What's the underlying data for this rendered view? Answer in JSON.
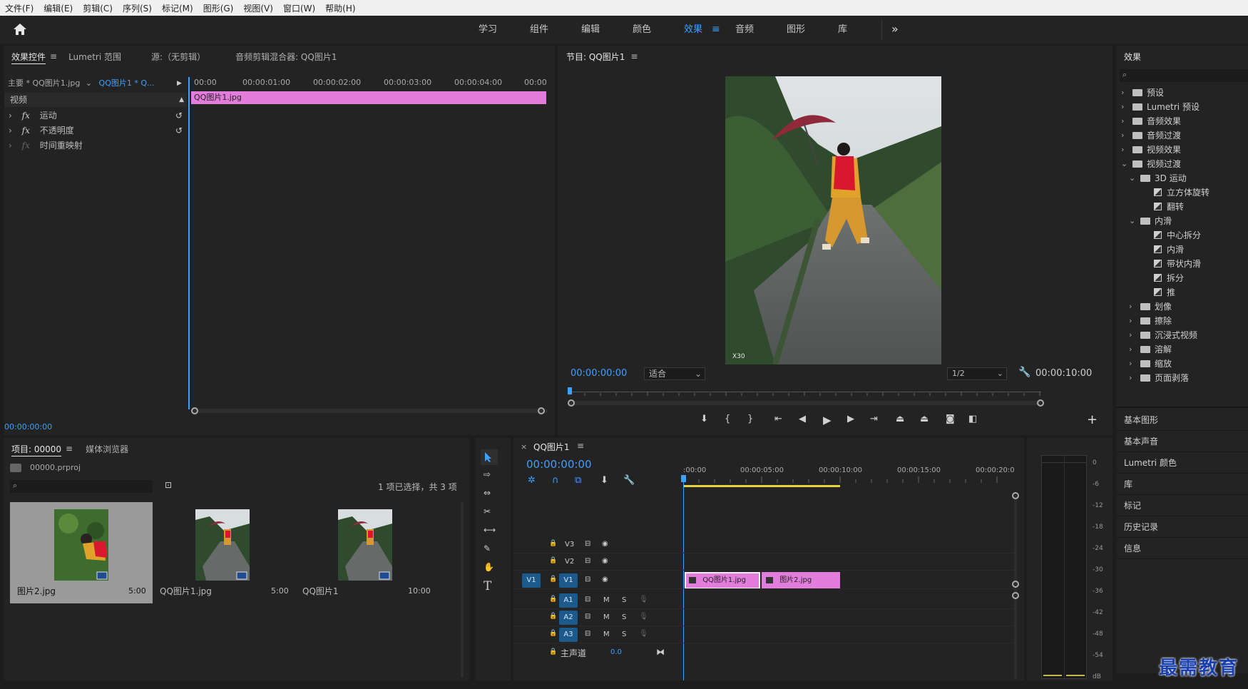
{
  "menu": [
    "文件(F)",
    "编辑(E)",
    "剪辑(C)",
    "序列(S)",
    "标记(M)",
    "图形(G)",
    "视图(V)",
    "窗口(W)",
    "帮助(H)"
  ],
  "workspaces": [
    "学习",
    "组件",
    "编辑",
    "颜色",
    "效果",
    "音频",
    "图形",
    "库"
  ],
  "active_workspace": "效果",
  "effect_controls": {
    "tabs": [
      "效果控件",
      "Lumetri 范围",
      "源:（无剪辑）",
      "音频剪辑混合器: QQ图片1"
    ],
    "source": "主要 * QQ图片1.jpg",
    "sequence": "QQ图片1 * Q...",
    "ruler": [
      "00:00",
      "00:00:01:00",
      "00:00:02:00",
      "00:00:03:00",
      "00:00:04:00",
      "00:00"
    ],
    "clip": "QQ图片1.jpg",
    "section": "视频",
    "props": [
      "运动",
      "不透明度",
      "时间重映射"
    ],
    "fx_label": "fx",
    "timecode": "00:00:00:00"
  },
  "program": {
    "title": "节目: QQ图片1",
    "timecode": "00:00:00:00",
    "fit": "适合",
    "resolution": "1/2",
    "duration": "00:00:10:00",
    "watermark": "X30"
  },
  "effects_panel": {
    "title": "效果",
    "tree": [
      {
        "label": "预设",
        "level": 0,
        "kind": "folder",
        "open": false
      },
      {
        "label": "Lumetri 预设",
        "level": 0,
        "kind": "folder",
        "open": false
      },
      {
        "label": "音频效果",
        "level": 0,
        "kind": "folder",
        "open": false
      },
      {
        "label": "音频过渡",
        "level": 0,
        "kind": "folder",
        "open": false
      },
      {
        "label": "视频效果",
        "level": 0,
        "kind": "folder",
        "open": false
      },
      {
        "label": "视频过渡",
        "level": 0,
        "kind": "folder",
        "open": true
      },
      {
        "label": "3D 运动",
        "level": 1,
        "kind": "folder",
        "open": true
      },
      {
        "label": "立方体旋转",
        "level": 2,
        "kind": "item"
      },
      {
        "label": "翻转",
        "level": 2,
        "kind": "item"
      },
      {
        "label": "内滑",
        "level": 1,
        "kind": "folder",
        "open": true
      },
      {
        "label": "中心拆分",
        "level": 2,
        "kind": "item"
      },
      {
        "label": "内滑",
        "level": 2,
        "kind": "item"
      },
      {
        "label": "带状内滑",
        "level": 2,
        "kind": "item"
      },
      {
        "label": "拆分",
        "level": 2,
        "kind": "item"
      },
      {
        "label": "推",
        "level": 2,
        "kind": "item"
      },
      {
        "label": "划像",
        "level": 1,
        "kind": "folder",
        "open": false
      },
      {
        "label": "擦除",
        "level": 1,
        "kind": "folder",
        "open": false
      },
      {
        "label": "沉浸式视频",
        "level": 1,
        "kind": "folder",
        "open": false
      },
      {
        "label": "溶解",
        "level": 1,
        "kind": "folder",
        "open": false
      },
      {
        "label": "缩放",
        "level": 1,
        "kind": "folder",
        "open": false
      },
      {
        "label": "页面剥落",
        "level": 1,
        "kind": "folder",
        "open": false
      }
    ],
    "panels": [
      "基本图形",
      "基本声音",
      "Lumetri 颜色",
      "库",
      "标记",
      "历史记录",
      "信息"
    ]
  },
  "project": {
    "tabs": [
      "项目: 00000",
      "媒体浏览器"
    ],
    "file": "00000.prproj",
    "status": "1 项已选择，共 3 项",
    "items": [
      {
        "name": "图片2.jpg",
        "duration": "5:00"
      },
      {
        "name": "QQ图片1.jpg",
        "duration": "5:00"
      },
      {
        "name": "QQ图片1",
        "duration": "10:00"
      }
    ]
  },
  "timeline": {
    "title": "QQ图片1",
    "timecode": "00:00:00:00",
    "ruler": [
      ":00:00",
      "00:00:05:00",
      "00:00:10:00",
      "00:00:15:00",
      "00:00:20:0"
    ],
    "video_tracks": [
      "V3",
      "V2",
      "V1"
    ],
    "audio_tracks": [
      "A1",
      "A2",
      "A3"
    ],
    "source_track": "V1",
    "master": "主声道",
    "master_value": "0.0",
    "clips": [
      "QQ图片1.jpg",
      "图片2.jpg"
    ],
    "m_label": "M",
    "s_label": "S"
  },
  "meter": {
    "labels": [
      "0",
      "-6",
      "-12",
      "-18",
      "-24",
      "-30",
      "-36",
      "-42",
      "-48",
      "-54",
      "dB"
    ]
  },
  "brand": "最需教育",
  "colors": {
    "accent": "#3ea0ff",
    "clip": "#e27ddc",
    "track": "#1d5a8c"
  }
}
